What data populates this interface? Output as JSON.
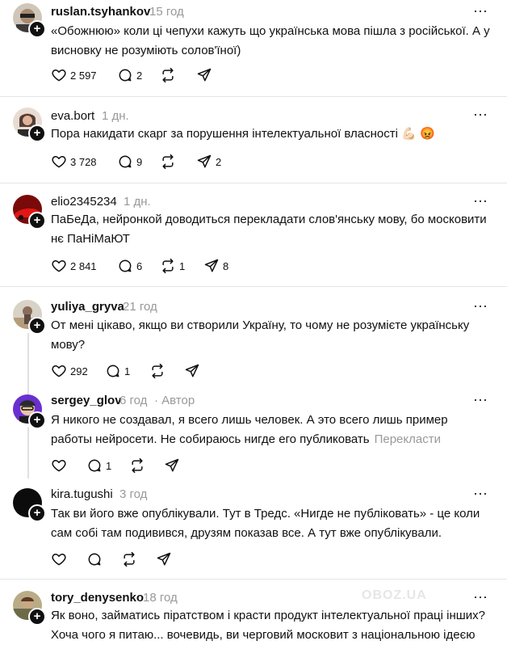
{
  "posts": [
    {
      "username": "ruslan.tsyhankov",
      "time": "15 год",
      "text": "«Обожнюю» коли ці чепухи кажуть що українська мова пішла з російської. А у висновку не розуміють солов'їної)",
      "likes": "2 597",
      "replies": "2",
      "reposts": "",
      "shares": ""
    },
    {
      "username": "eva.bort",
      "time": "1 дн.",
      "text": "Пора накидати скарг за порушення інтелектуальної власності 💪🏻 😡",
      "likes": "3 728",
      "replies": "9",
      "reposts": "",
      "shares": "2"
    },
    {
      "username": "elio2345234",
      "time": "1 дн.",
      "text": "ПаБеДа, нейронкой доводиться перекладати слов'янську мову, бо московити нє ПаНіМаЮТ",
      "likes": "2 841",
      "replies": "6",
      "reposts": "1",
      "shares": "8"
    },
    {
      "username": "yuliya_gryva",
      "time": "21 год",
      "text": "От мені цікаво, якщо ви створили Україну, то чому не розумієте українську мову?",
      "likes": "292",
      "replies": "1",
      "reposts": "",
      "shares": ""
    },
    {
      "username": "sergey_glov",
      "time": "6 год",
      "author_badge": "· Автор",
      "text": "Я никого не создавал, я всего лишь человек. А это всего лишь пример работы нейросети. Не собираюсь нигде его публиковать",
      "translate": "Перекласти",
      "likes": "",
      "replies": "1",
      "reposts": "",
      "shares": ""
    },
    {
      "username": "kira.tugushi",
      "time": "3 год",
      "text": "Так ви його вже опублікували. Тут в Тредс. «Нигде не публіковать» - це коли сам собі там подивився, друзям показав все. А тут вже опублікували.",
      "likes": "",
      "replies": "",
      "reposts": "",
      "shares": ""
    },
    {
      "username": "tory_denysenko",
      "time": "18 год",
      "text": "Як воно, займатись піратством і красти продукт інтелектуальної праці інших? Хоча чого я питаю... вочевидь, ви черговий московит з національною ідеєю",
      "likes": "",
      "replies": "",
      "reposts": "",
      "shares": ""
    }
  ],
  "watermark": "OBOZ.UA",
  "more_glyph": "···",
  "plus_glyph": "+"
}
